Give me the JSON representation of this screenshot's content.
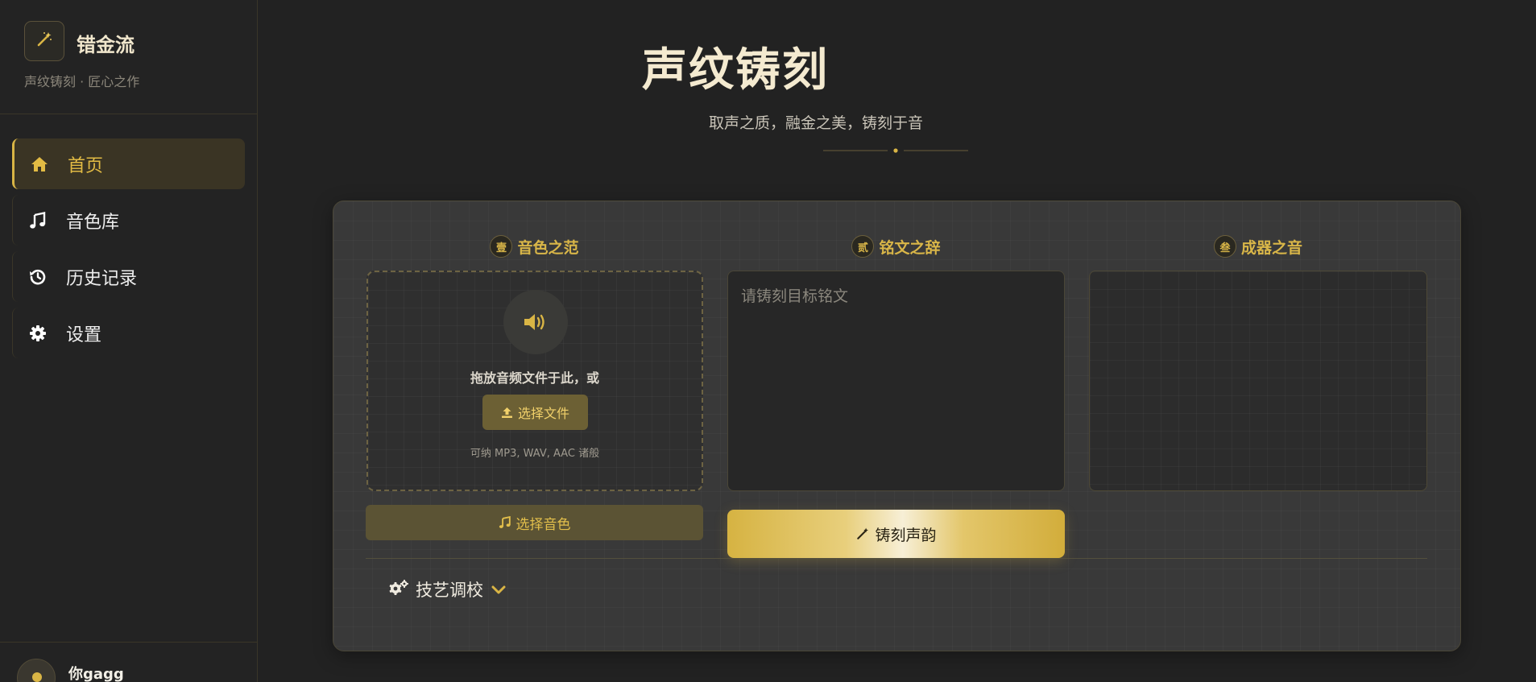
{
  "brand": {
    "name": "错金流",
    "subtitle": "声纹铸刻 · 匠心之作",
    "logo_icon": "magic-wand-icon"
  },
  "sidebar": {
    "items": [
      {
        "label": "首页",
        "icon": "home-icon",
        "active": true
      },
      {
        "label": "音色库",
        "icon": "music-note-icon",
        "active": false
      },
      {
        "label": "历史记录",
        "icon": "history-icon",
        "active": false
      },
      {
        "label": "设置",
        "icon": "gear-icon",
        "active": false
      }
    ]
  },
  "user": {
    "name": "你gagg",
    "avatar_icon": "user-icon"
  },
  "hero": {
    "title": "声纹铸刻",
    "subtitle": "取声之质，融金之美，铸刻于音"
  },
  "panel": {
    "columns": [
      {
        "seal": "壹",
        "title": "音色之范"
      },
      {
        "seal": "贰",
        "title": "铭文之辞"
      },
      {
        "seal": "叁",
        "title": "成器之音"
      }
    ],
    "upload": {
      "drop_text": "拖放音频文件于此，或",
      "button_label": "选择文件",
      "hint": "可纳 MP3, WAV, AAC 诸般"
    },
    "voice_button_label": "选择音色",
    "text_input": {
      "placeholder": "请铸刻目标铭文",
      "value": ""
    },
    "cast_button_label": "铸刻声韵",
    "advanced_label": "技艺调校"
  },
  "colors": {
    "accent": "#d9b545",
    "background": "#222222",
    "card": "#393939"
  }
}
